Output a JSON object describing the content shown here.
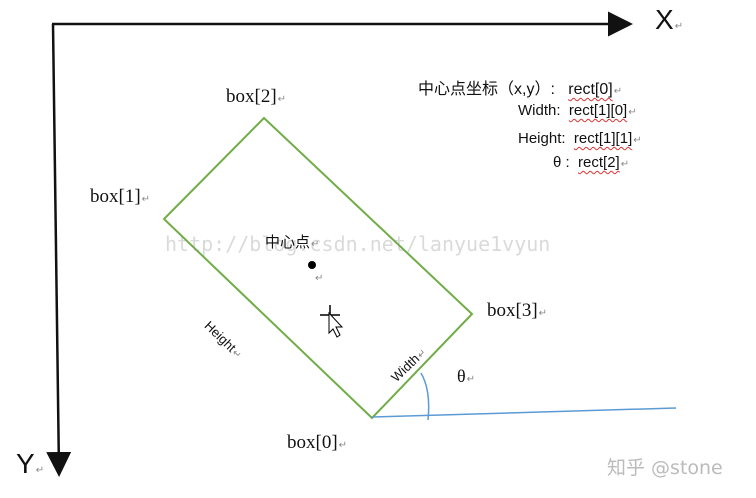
{
  "axes": {
    "x_label": "X",
    "y_label": "Y"
  },
  "corners": {
    "box0": "box[0]",
    "box1": "box[1]",
    "box2": "box[2]",
    "box3": "box[3]"
  },
  "rect_labels": {
    "center": "中心点",
    "height": "Height",
    "width": "Width",
    "theta": "θ"
  },
  "legend": [
    {
      "key": "中心点坐标（x,y）:",
      "value": "rect[0]"
    },
    {
      "key": "Width:",
      "value": "rect[1][0]"
    },
    {
      "key": "Height:",
      "value": "rect[1][1]"
    },
    {
      "key": "θ :",
      "value": "rect[2]"
    }
  ],
  "return_mark": "↵",
  "watermark": "http://blog.csdn.net/lanyue1vyun",
  "credit": "知乎 @stone",
  "colors": {
    "rect": "#70ad47",
    "angle_line": "#5b9bd5",
    "axes": "#111111"
  }
}
